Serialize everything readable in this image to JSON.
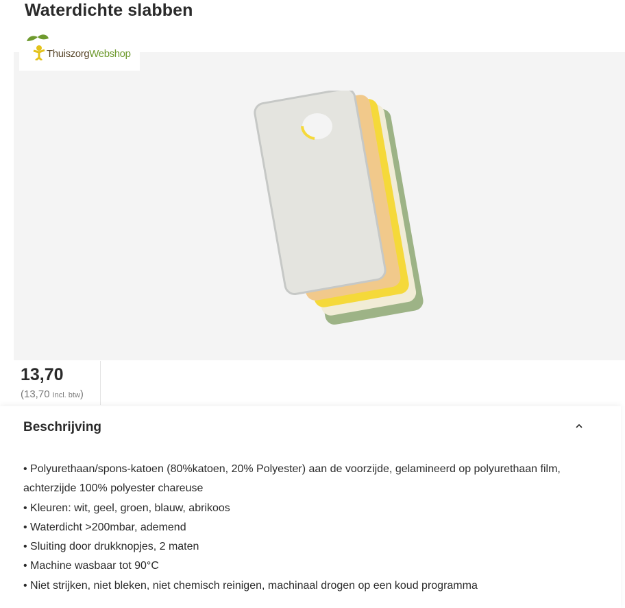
{
  "page": {
    "title": "Waterdichte slabben"
  },
  "logo": {
    "text_part1": "Thuiszorg",
    "text_part2": "Webshop"
  },
  "product": {
    "image_icon": "bibs-product-image",
    "colors": [
      "#c9cbc9",
      "#f1c98b",
      "#f5d93a",
      "#f1ecd6",
      "#9db386"
    ]
  },
  "price": {
    "amount": "13,70",
    "incl_amount": "13,70",
    "incl_label": "Incl. btw"
  },
  "description": {
    "heading": "Beschrijving",
    "toggle_icon": "chevron-up-icon",
    "items": [
      "Polyurethaan/spons-katoen (80%katoen, 20% Polyester) aan de voorzijde, gelamineerd op polyurethaan film, achterzijde 100% polyester chareuse",
      "Kleuren: wit, geel, groen, blauw, abrikoos",
      "Waterdicht >200mbar, ademend",
      "Sluiting door drukknopjes, 2 maten",
      "Machine wasbaar tot 90°C",
      "Niet strijken, niet bleken, niet chemisch reinigen, machinaal drogen op een koud programma"
    ]
  }
}
